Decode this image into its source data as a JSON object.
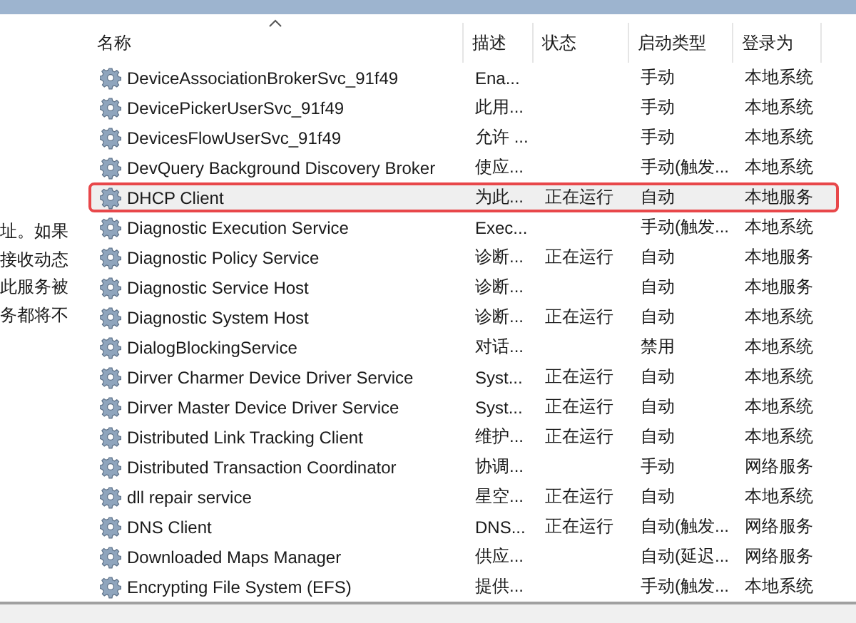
{
  "description_panel": {
    "lines": [
      "址。如果",
      "接收动态",
      "此服务被",
      "务都将不"
    ]
  },
  "table": {
    "columns": [
      {
        "label": "名称",
        "sorted": true
      },
      {
        "label": "描述",
        "sorted": false
      },
      {
        "label": "状态",
        "sorted": false
      },
      {
        "label": "启动类型",
        "sorted": false
      },
      {
        "label": "登录为",
        "sorted": false
      }
    ],
    "rows": [
      {
        "name": "DeviceAssociationBrokerSvc_91f49",
        "description": "Ena...",
        "status": "",
        "startup": "手动",
        "logon": "本地系统",
        "selected": false
      },
      {
        "name": "DevicePickerUserSvc_91f49",
        "description": "此用...",
        "status": "",
        "startup": "手动",
        "logon": "本地系统",
        "selected": false
      },
      {
        "name": "DevicesFlowUserSvc_91f49",
        "description": "允许 ...",
        "status": "",
        "startup": "手动",
        "logon": "本地系统",
        "selected": false
      },
      {
        "name": "DevQuery Background Discovery Broker",
        "description": "使应...",
        "status": "",
        "startup": "手动(触发...",
        "logon": "本地系统",
        "selected": false
      },
      {
        "name": "DHCP Client",
        "description": "为此...",
        "status": "正在运行",
        "startup": "自动",
        "logon": "本地服务",
        "selected": true
      },
      {
        "name": "Diagnostic Execution Service",
        "description": "Exec...",
        "status": "",
        "startup": "手动(触发...",
        "logon": "本地系统",
        "selected": false
      },
      {
        "name": "Diagnostic Policy Service",
        "description": "诊断...",
        "status": "正在运行",
        "startup": "自动",
        "logon": "本地服务",
        "selected": false
      },
      {
        "name": "Diagnostic Service Host",
        "description": "诊断...",
        "status": "",
        "startup": "自动",
        "logon": "本地服务",
        "selected": false
      },
      {
        "name": "Diagnostic System Host",
        "description": "诊断...",
        "status": "正在运行",
        "startup": "自动",
        "logon": "本地系统",
        "selected": false
      },
      {
        "name": "DialogBlockingService",
        "description": "对话...",
        "status": "",
        "startup": "禁用",
        "logon": "本地系统",
        "selected": false
      },
      {
        "name": "Dirver Charmer Device Driver Service",
        "description": "Syst...",
        "status": "正在运行",
        "startup": "自动",
        "logon": "本地系统",
        "selected": false
      },
      {
        "name": "Dirver Master Device Driver Service",
        "description": "Syst...",
        "status": "正在运行",
        "startup": "自动",
        "logon": "本地系统",
        "selected": false
      },
      {
        "name": "Distributed Link Tracking Client",
        "description": "维护...",
        "status": "正在运行",
        "startup": "自动",
        "logon": "本地系统",
        "selected": false
      },
      {
        "name": "Distributed Transaction Coordinator",
        "description": "协调...",
        "status": "",
        "startup": "手动",
        "logon": "网络服务",
        "selected": false
      },
      {
        "name": "dll repair service",
        "description": "星空...",
        "status": "正在运行",
        "startup": "自动",
        "logon": "本地系统",
        "selected": false
      },
      {
        "name": "DNS Client",
        "description": "DNS...",
        "status": "正在运行",
        "startup": "自动(触发...",
        "logon": "网络服务",
        "selected": false
      },
      {
        "name": "Downloaded Maps Manager",
        "description": "供应...",
        "status": "",
        "startup": "自动(延迟...",
        "logon": "网络服务",
        "selected": false
      },
      {
        "name": "Encrypting File System (EFS)",
        "description": "提供...",
        "status": "",
        "startup": "手动(触发...",
        "logon": "本地系统",
        "selected": false
      }
    ]
  }
}
